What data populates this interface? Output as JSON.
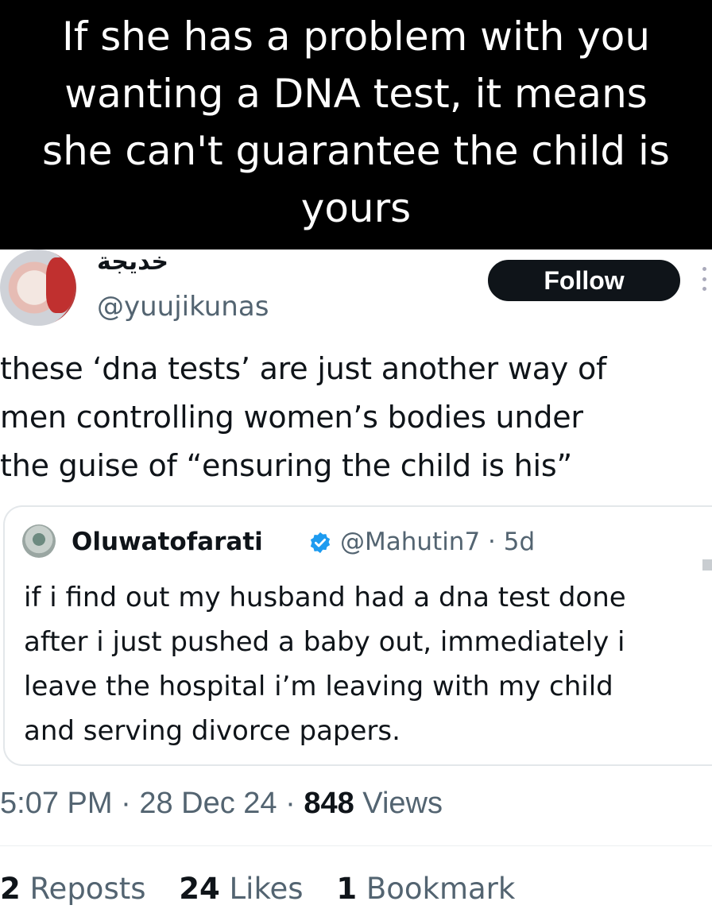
{
  "caption": "If she has a problem with you wanting a DNA test, it means she can't guarantee the child is yours",
  "tweet": {
    "display_name": "خديجة",
    "handle": "@yuujikunas",
    "follow_label": "Follow",
    "text": "these ‘dna tests’ are just another way of\nmen controlling women’s bodies under\nthe guise of “ensuring the child is his”"
  },
  "quote": {
    "name": "Oluwatofarati",
    "handle_time": "@Mahutin7 · 5d",
    "text": "if i find out my husband had a dna test done\nafter i just pushed a baby out, immediately i\nleave the hospital i’m leaving with my child\nand serving divorce papers."
  },
  "meta": {
    "time": "5:07 PM",
    "date": "28 Dec 24",
    "views_count": "848",
    "views_label": "Views"
  },
  "stats": {
    "reposts_count": "2",
    "reposts_label": "Reposts",
    "likes_count": "24",
    "likes_label": "Likes",
    "bookmarks_count": "1",
    "bookmarks_label": "Bookmark"
  },
  "colors": {
    "accent_verified": "#1d9bf0",
    "muted_text": "#536471",
    "caption_bg": "#000000"
  }
}
